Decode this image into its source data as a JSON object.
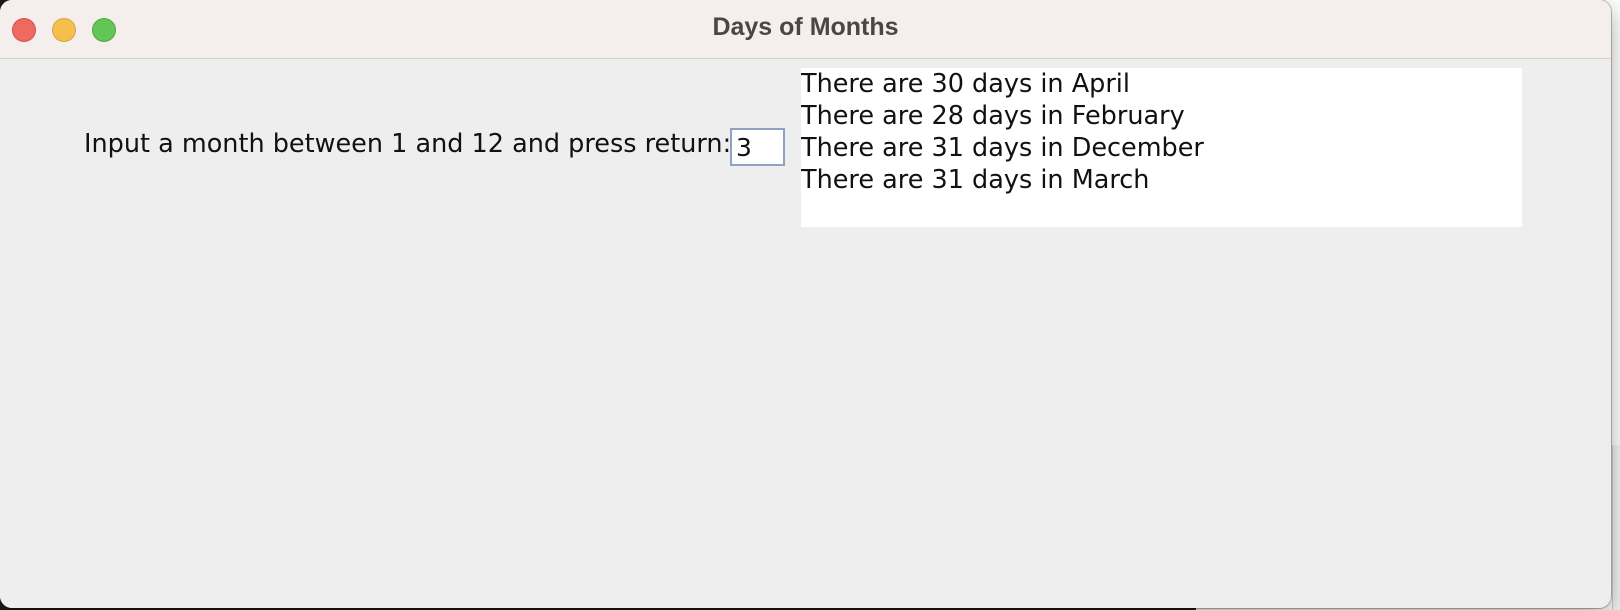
{
  "window": {
    "title": "Days of Months"
  },
  "form": {
    "prompt_label": "Input a month between 1 and 12 and press return:",
    "month_input_value": "3"
  },
  "output": {
    "lines": [
      "There are 30 days in April",
      "There are 28 days in February",
      "There are 31 days in December",
      "There are 31 days in March"
    ]
  },
  "colors": {
    "close": "#ee6a5f",
    "minimize": "#f5bf4f",
    "zoom": "#62c554",
    "titlebar": "#f4efec",
    "content_background": "#eeeeee"
  }
}
